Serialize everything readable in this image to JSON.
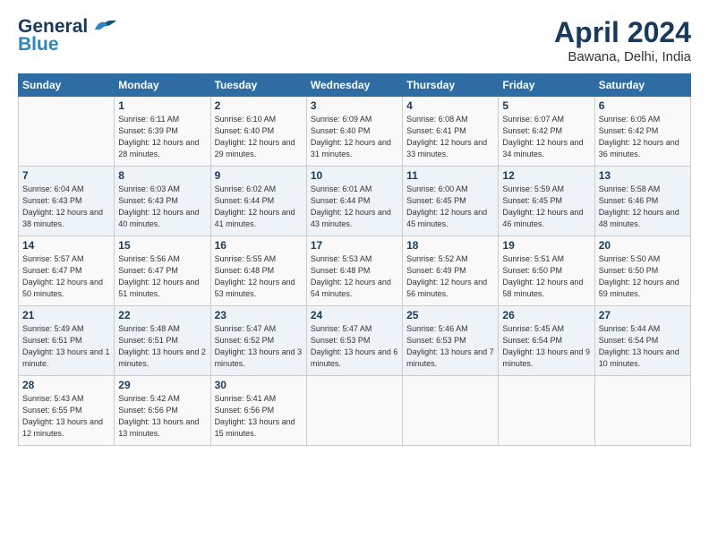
{
  "logo": {
    "line1": "General",
    "line2": "Blue"
  },
  "title": "April 2024",
  "subtitle": "Bawana, Delhi, India",
  "headers": [
    "Sunday",
    "Monday",
    "Tuesday",
    "Wednesday",
    "Thursday",
    "Friday",
    "Saturday"
  ],
  "weeks": [
    [
      {
        "day": "",
        "info": ""
      },
      {
        "day": "1",
        "info": "Sunrise: 6:11 AM\nSunset: 6:39 PM\nDaylight: 12 hours\nand 28 minutes."
      },
      {
        "day": "2",
        "info": "Sunrise: 6:10 AM\nSunset: 6:40 PM\nDaylight: 12 hours\nand 29 minutes."
      },
      {
        "day": "3",
        "info": "Sunrise: 6:09 AM\nSunset: 6:40 PM\nDaylight: 12 hours\nand 31 minutes."
      },
      {
        "day": "4",
        "info": "Sunrise: 6:08 AM\nSunset: 6:41 PM\nDaylight: 12 hours\nand 33 minutes."
      },
      {
        "day": "5",
        "info": "Sunrise: 6:07 AM\nSunset: 6:42 PM\nDaylight: 12 hours\nand 34 minutes."
      },
      {
        "day": "6",
        "info": "Sunrise: 6:05 AM\nSunset: 6:42 PM\nDaylight: 12 hours\nand 36 minutes."
      }
    ],
    [
      {
        "day": "7",
        "info": "Sunrise: 6:04 AM\nSunset: 6:43 PM\nDaylight: 12 hours\nand 38 minutes."
      },
      {
        "day": "8",
        "info": "Sunrise: 6:03 AM\nSunset: 6:43 PM\nDaylight: 12 hours\nand 40 minutes."
      },
      {
        "day": "9",
        "info": "Sunrise: 6:02 AM\nSunset: 6:44 PM\nDaylight: 12 hours\nand 41 minutes."
      },
      {
        "day": "10",
        "info": "Sunrise: 6:01 AM\nSunset: 6:44 PM\nDaylight: 12 hours\nand 43 minutes."
      },
      {
        "day": "11",
        "info": "Sunrise: 6:00 AM\nSunset: 6:45 PM\nDaylight: 12 hours\nand 45 minutes."
      },
      {
        "day": "12",
        "info": "Sunrise: 5:59 AM\nSunset: 6:45 PM\nDaylight: 12 hours\nand 46 minutes."
      },
      {
        "day": "13",
        "info": "Sunrise: 5:58 AM\nSunset: 6:46 PM\nDaylight: 12 hours\nand 48 minutes."
      }
    ],
    [
      {
        "day": "14",
        "info": "Sunrise: 5:57 AM\nSunset: 6:47 PM\nDaylight: 12 hours\nand 50 minutes."
      },
      {
        "day": "15",
        "info": "Sunrise: 5:56 AM\nSunset: 6:47 PM\nDaylight: 12 hours\nand 51 minutes."
      },
      {
        "day": "16",
        "info": "Sunrise: 5:55 AM\nSunset: 6:48 PM\nDaylight: 12 hours\nand 53 minutes."
      },
      {
        "day": "17",
        "info": "Sunrise: 5:53 AM\nSunset: 6:48 PM\nDaylight: 12 hours\nand 54 minutes."
      },
      {
        "day": "18",
        "info": "Sunrise: 5:52 AM\nSunset: 6:49 PM\nDaylight: 12 hours\nand 56 minutes."
      },
      {
        "day": "19",
        "info": "Sunrise: 5:51 AM\nSunset: 6:50 PM\nDaylight: 12 hours\nand 58 minutes."
      },
      {
        "day": "20",
        "info": "Sunrise: 5:50 AM\nSunset: 6:50 PM\nDaylight: 12 hours\nand 59 minutes."
      }
    ],
    [
      {
        "day": "21",
        "info": "Sunrise: 5:49 AM\nSunset: 6:51 PM\nDaylight: 13 hours\nand 1 minute."
      },
      {
        "day": "22",
        "info": "Sunrise: 5:48 AM\nSunset: 6:51 PM\nDaylight: 13 hours\nand 2 minutes."
      },
      {
        "day": "23",
        "info": "Sunrise: 5:47 AM\nSunset: 6:52 PM\nDaylight: 13 hours\nand 3 minutes."
      },
      {
        "day": "24",
        "info": "Sunrise: 5:47 AM\nSunset: 6:53 PM\nDaylight: 13 hours\nand 6 minutes."
      },
      {
        "day": "25",
        "info": "Sunrise: 5:46 AM\nSunset: 6:53 PM\nDaylight: 13 hours\nand 7 minutes."
      },
      {
        "day": "26",
        "info": "Sunrise: 5:45 AM\nSunset: 6:54 PM\nDaylight: 13 hours\nand 9 minutes."
      },
      {
        "day": "27",
        "info": "Sunrise: 5:44 AM\nSunset: 6:54 PM\nDaylight: 13 hours\nand 10 minutes."
      }
    ],
    [
      {
        "day": "28",
        "info": "Sunrise: 5:43 AM\nSunset: 6:55 PM\nDaylight: 13 hours\nand 12 minutes."
      },
      {
        "day": "29",
        "info": "Sunrise: 5:42 AM\nSunset: 6:56 PM\nDaylight: 13 hours\nand 13 minutes."
      },
      {
        "day": "30",
        "info": "Sunrise: 5:41 AM\nSunset: 6:56 PM\nDaylight: 13 hours\nand 15 minutes."
      },
      {
        "day": "",
        "info": ""
      },
      {
        "day": "",
        "info": ""
      },
      {
        "day": "",
        "info": ""
      },
      {
        "day": "",
        "info": ""
      }
    ]
  ]
}
